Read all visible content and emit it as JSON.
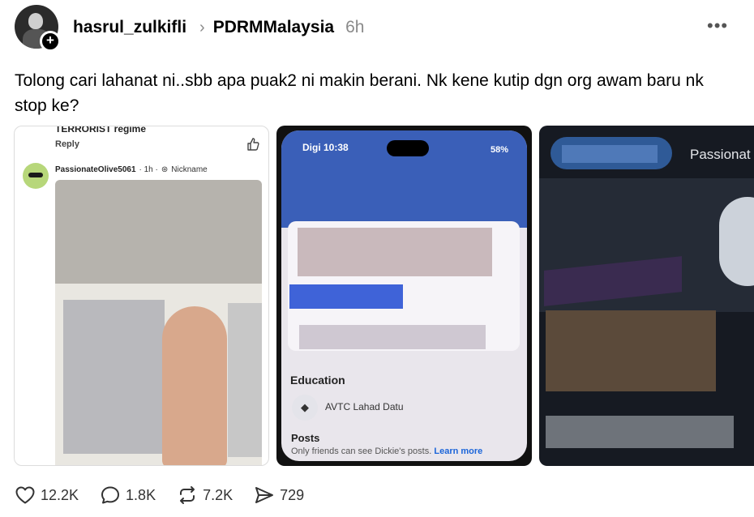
{
  "post": {
    "username": "hasrul_zulkifli",
    "community": "PDRMMalaysia",
    "time": "6h",
    "text": "Tolong cari lahanat ni..sbb apa puak2 ni makin berani. Nk kene kutip dgn org awam baru nk stop ke?"
  },
  "media": {
    "card1": {
      "top_text": "TERRORIST regime",
      "reply_label": "Reply",
      "commenter": "PassionateOlive5061",
      "comment_time": "· 1h ·",
      "nickname_label": "Nickname"
    },
    "card2": {
      "status_carrier": "Digi 10:38",
      "battery": "58%",
      "education_heading": "Education",
      "school": "AVTC Lahad Datu",
      "posts_heading": "Posts",
      "posts_notice": "Only friends can see Dickie's posts.",
      "learn_more": "Learn more"
    },
    "card3": {
      "name_fragment": "Passionat"
    }
  },
  "actions": {
    "likes": "12.2K",
    "comments": "1.8K",
    "reposts": "7.2K",
    "shares": "729"
  }
}
